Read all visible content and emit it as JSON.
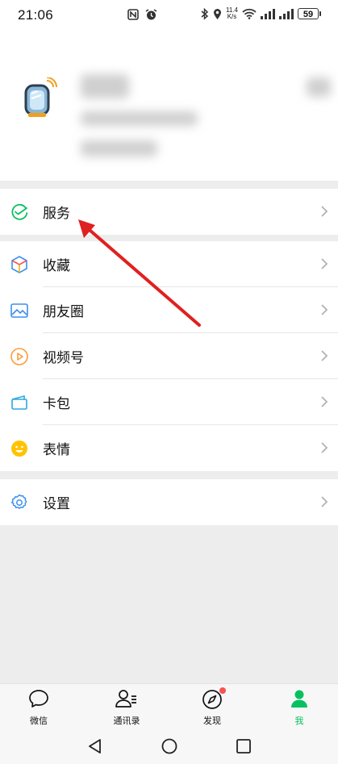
{
  "status_bar": {
    "time": "21:06",
    "net_speed_value": "11.4",
    "net_speed_unit": "K/s",
    "battery": "59",
    "icons": [
      "nfc-icon",
      "alarm-icon",
      "bluetooth-icon",
      "location-icon",
      "wifi-icon",
      "signal-icon",
      "signal-icon",
      "battery-icon"
    ]
  },
  "profile": {
    "avatar_icon": "smartwatch-avatar-icon",
    "chevron_icon": "chevron-right-icon"
  },
  "menu": {
    "service": {
      "label": "服务",
      "icon": "service-check-icon"
    },
    "items": [
      {
        "label": "收藏",
        "icon": "favorites-cube-icon"
      },
      {
        "label": "朋友圈",
        "icon": "moments-image-icon"
      },
      {
        "label": "视频号",
        "icon": "channels-play-icon"
      },
      {
        "label": "卡包",
        "icon": "card-wallet-icon"
      },
      {
        "label": "表情",
        "icon": "sticker-smile-icon"
      }
    ],
    "settings": {
      "label": "设置",
      "icon": "settings-gear-icon"
    }
  },
  "tabbar": {
    "tabs": [
      {
        "label": "微信",
        "icon": "chat-bubble-icon",
        "active": false
      },
      {
        "label": "通讯录",
        "icon": "contacts-icon",
        "active": false
      },
      {
        "label": "发现",
        "icon": "compass-icon",
        "active": false,
        "badge": true
      },
      {
        "label": "我",
        "icon": "person-icon",
        "active": true
      }
    ]
  },
  "colors": {
    "accent": "#07c160",
    "badge": "#fa5151",
    "annotation_arrow": "#e02020"
  }
}
